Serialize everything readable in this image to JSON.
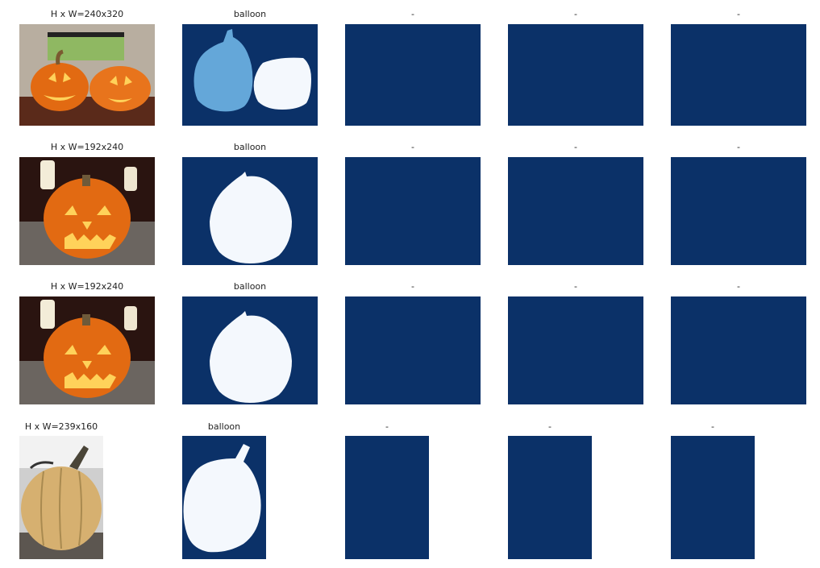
{
  "rows": [
    {
      "image_title": "H x W=240x320",
      "mask_titles": [
        "balloon",
        "-",
        "-",
        "-"
      ]
    },
    {
      "image_title": "H x W=192x240",
      "mask_titles": [
        "balloon",
        "-",
        "-",
        "-"
      ]
    },
    {
      "image_title": "H x W=192x240",
      "mask_titles": [
        "balloon",
        "-",
        "-",
        "-"
      ]
    },
    {
      "image_title": "H x W=239x160",
      "mask_titles": [
        "balloon",
        "-",
        "-",
        "-"
      ]
    }
  ],
  "colors": {
    "background": "#0b3168",
    "mask_white": "#f4f8fd",
    "mask_light_blue": "#64a7d9",
    "pumpkin_orange": "#e26a12",
    "pumpkin_light": "#f08a2a",
    "carved_glow": "#ffd25a"
  }
}
